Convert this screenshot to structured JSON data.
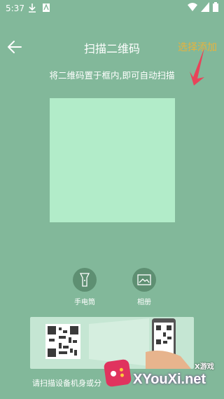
{
  "status_bar": {
    "time": "5:37"
  },
  "header": {
    "title": "扫描二维码",
    "add_label": "选择添加"
  },
  "hint": "将二维码置于框内,即可自动扫描",
  "tools": [
    {
      "label": "手电筒",
      "icon": "flashlight-icon"
    },
    {
      "label": "相册",
      "icon": "gallery-icon"
    }
  ],
  "banner": {
    "caption": "请扫描设备机身或分"
  },
  "watermark": {
    "text": "XYouXi.net",
    "tag": "X游戏"
  },
  "colors": {
    "background": "#82b89a",
    "scan_area": "#b2ecc9",
    "accent": "#e8b23c",
    "arrow": "#e8445a"
  }
}
